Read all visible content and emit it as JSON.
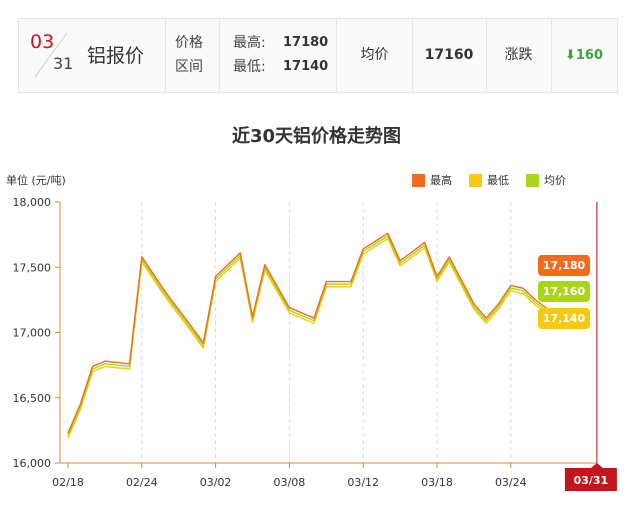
{
  "header": {
    "month": "03",
    "day": "31",
    "title": "铝报价",
    "label_price": "价格",
    "label_range": "区间",
    "high_label": "最高:",
    "high_value": "17180",
    "low_label": "最低:",
    "low_value": "17140",
    "avg_label": "均价",
    "avg_value": "17160",
    "change_label": "涨跌",
    "change_value": "160",
    "change_color": "#3aa63a"
  },
  "chart_data": {
    "type": "line",
    "title": "近30天铝价格走势图",
    "unit": "单位 (元/吨)",
    "ylim": [
      16000,
      18000
    ],
    "yticks": [
      "16,000",
      "16,500",
      "17,000",
      "17,500",
      "18,000"
    ],
    "ytick_values": [
      16000,
      16500,
      17000,
      17500,
      18000
    ],
    "x_tick_labels": [
      "02/18",
      "02/24",
      "03/02",
      "03/08",
      "03/12",
      "03/18",
      "03/24",
      "03/31"
    ],
    "x_tick_index": [
      0,
      6,
      12,
      18,
      24,
      30,
      36,
      43
    ],
    "grid": "vertical dashed",
    "legend_position": "top-right",
    "series": [
      {
        "name": "最高",
        "color": "#f26b1d",
        "values": [
          16230,
          16450,
          16740,
          16780,
          16760,
          17580,
          17300,
          17050,
          16920,
          17430,
          17610,
          17120,
          17520,
          17190,
          17110,
          17390,
          17390,
          17640,
          17760,
          17550,
          17690,
          17430,
          17580,
          17220,
          17110,
          17220,
          17360,
          17340,
          17250,
          17180
        ]
      },
      {
        "name": "最低",
        "color": "#f7c90f",
        "values": [
          16190,
          16410,
          16700,
          16740,
          16720,
          17540,
          17260,
          17010,
          16880,
          17390,
          17570,
          17080,
          17480,
          17150,
          17070,
          17350,
          17350,
          17600,
          17720,
          17510,
          17650,
          17390,
          17540,
          17180,
          17070,
          17180,
          17320,
          17300,
          17210,
          17140
        ]
      },
      {
        "name": "均价",
        "color": "#a9d51b",
        "values": [
          16210,
          16430,
          16720,
          16760,
          16740,
          17560,
          17280,
          17030,
          16900,
          17410,
          17590,
          17100,
          17500,
          17170,
          17090,
          17370,
          17370,
          17620,
          17740,
          17530,
          17670,
          17410,
          17560,
          17200,
          17090,
          17200,
          17340,
          17320,
          17230,
          17160
        ]
      }
    ],
    "x_index": [
      0,
      1,
      2,
      3,
      5,
      6,
      8,
      10,
      11,
      12,
      14,
      15,
      16,
      18,
      20,
      21,
      23,
      24,
      26,
      27,
      29,
      30,
      31,
      33,
      34,
      35,
      36,
      37,
      38,
      39
    ],
    "tooltip": {
      "date": "03/31",
      "high": "17,180",
      "avg": "17,160",
      "low": "17,140"
    }
  }
}
